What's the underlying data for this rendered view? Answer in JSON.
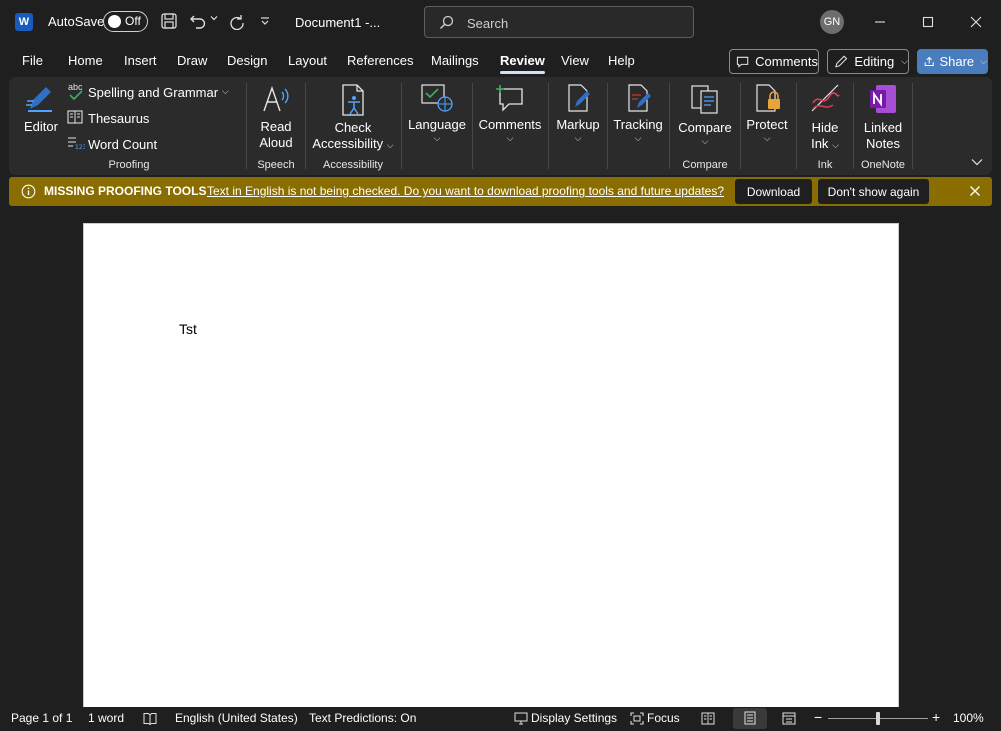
{
  "titlebar": {
    "logo_letter": "W",
    "autosave_label": "AutoSave",
    "autosave_state": "Off",
    "document_title": "Document1  -...",
    "search_placeholder": "Search",
    "user_initials": "GN"
  },
  "tabs": [
    "File",
    "Home",
    "Insert",
    "Draw",
    "Design",
    "Layout",
    "References",
    "Mailings",
    "Review",
    "View",
    "Help"
  ],
  "active_tab": "Review",
  "toolbar_right": {
    "comments_label": "Comments",
    "editing_label": "Editing",
    "share_label": "Share"
  },
  "ribbon": {
    "proofing": {
      "editor": "Editor",
      "spelling": "Spelling and Grammar",
      "abc": "abc",
      "thesaurus": "Thesaurus",
      "word_count": "Word Count",
      "group": "Proofing"
    },
    "speech": {
      "read_line1": "Read",
      "read_line2": "Aloud",
      "group": "Speech"
    },
    "accessibility": {
      "line1": "Check",
      "line2": "Accessibility",
      "group": "Accessibility"
    },
    "language": {
      "label": "Language"
    },
    "comments": {
      "label": "Comments"
    },
    "markup": {
      "label": "Markup"
    },
    "tracking": {
      "label": "Tracking"
    },
    "compare": {
      "label": "Compare",
      "group": "Compare"
    },
    "protect": {
      "label": "Protect"
    },
    "ink": {
      "line1": "Hide",
      "line2": "Ink",
      "group": "Ink"
    },
    "onenote": {
      "line1": "Linked",
      "line2": "Notes",
      "group": "OneNote"
    }
  },
  "message_bar": {
    "title": "MISSING PROOFING TOOLS",
    "text": "Text in English is not being checked. Do you want to download proofing tools and future updates?",
    "download": "Download",
    "dont_show": "Don't show again"
  },
  "document": {
    "body_text": "Tst"
  },
  "statusbar": {
    "page": "Page 1 of 1",
    "words": "1 word",
    "language": "English (United States)",
    "predictions": "Text Predictions: On",
    "display_settings": "Display Settings",
    "focus": "Focus",
    "zoom": "100%",
    "zoom_minus": "−",
    "zoom_plus": "+"
  },
  "colors": {
    "background": "#1f1f1f",
    "ribbon": "#2b2b2b",
    "accent_blue": "#4a7dbd",
    "message_bar": "#8a6d00",
    "onenote_purple": "#7719aa"
  }
}
